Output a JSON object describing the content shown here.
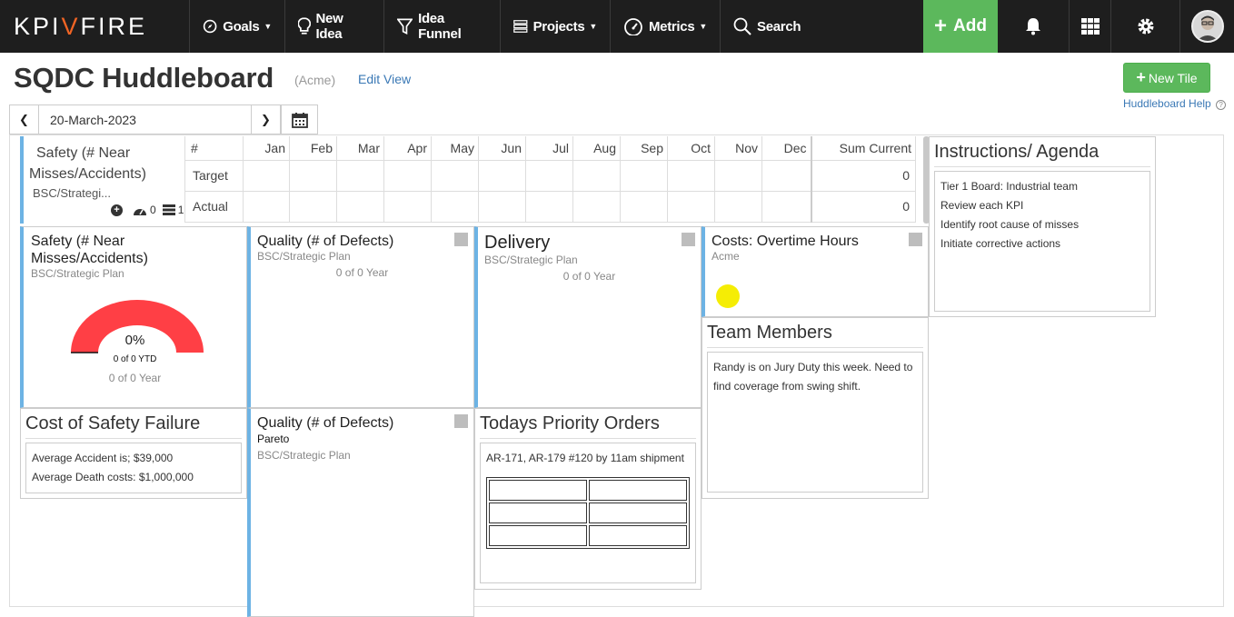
{
  "nav": {
    "logo_left": "KPI",
    "logo_v": "V",
    "logo_right": "FIRE",
    "goals": "Goals",
    "new_idea": "New Idea",
    "idea_funnel": "Idea Funnel",
    "projects": "Projects",
    "metrics": "Metrics",
    "search": "Search",
    "add": "Add"
  },
  "header": {
    "title": "SQDC Huddleboard",
    "org": "(Acme)",
    "edit_view": "Edit View",
    "new_tile": "New Tile",
    "help": "Huddleboard Help",
    "date": "20-March-2023"
  },
  "safety_table": {
    "title": "Safety (# Near Misses/Accidents)",
    "sub": "BSC/Strategi...",
    "count_a": "0",
    "count_b": "1",
    "hash": "#",
    "months": [
      "Jan",
      "Feb",
      "Mar",
      "Apr",
      "May",
      "Jun",
      "Jul",
      "Aug",
      "Sep",
      "Oct",
      "Nov",
      "Dec"
    ],
    "sum_label": "Sum Current",
    "target_label": "Target",
    "actual_label": "Actual",
    "target_sum": "0",
    "actual_sum": "0"
  },
  "tiles": {
    "safety_gauge": {
      "title": "Safety (# Near Misses/Accidents)",
      "sub": "BSC/Strategic Plan",
      "pct": "0%",
      "ytd": "0 of 0 YTD",
      "year": "0 of 0 Year"
    },
    "quality1": {
      "title": "Quality (# of Defects)",
      "sub": "BSC/Strategic Plan",
      "year": "0 of 0 Year"
    },
    "delivery": {
      "title": "Delivery",
      "sub": "BSC/Strategic Plan",
      "year": "0 of 0 Year"
    },
    "costs": {
      "title": "Costs: Overtime Hours",
      "sub": "Acme"
    },
    "instructions": {
      "title": "Instructions/ Agenda",
      "lines": [
        "Tier 1 Board: Industrial team",
        "Review each KPI",
        "Identify root cause of misses",
        "Initiate corrective actions"
      ]
    },
    "team": {
      "title": "Team Members",
      "text": "Randy is on Jury Duty this week. Need to find coverage from swing shift."
    },
    "cost_failure": {
      "title": "Cost of Safety Failure",
      "line1": "Average Accident is; $39,000",
      "line2": "Average Death costs: $1,000,000"
    },
    "quality2": {
      "title": "Quality (# of Defects)",
      "pareto": "Pareto",
      "sub": "BSC/Strategic Plan"
    },
    "orders": {
      "title": "Todays Priority Orders",
      "text": "AR-171, AR-179 #120 by 11am shipment"
    }
  },
  "colors": {
    "accent_green": "#5cb85c",
    "kpi_blue": "#6db3e4",
    "gauge_red": "#ff3f45",
    "status_yellow": "#f5ed05"
  }
}
